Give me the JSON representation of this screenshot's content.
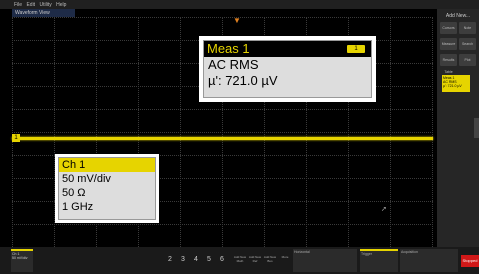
{
  "menu": [
    "File",
    "Edit",
    "Utility",
    "Help"
  ],
  "waveform_view_label": "Waveform View",
  "measurement_badge": {
    "title": "Meas 1",
    "number": "1",
    "type": "AC RMS",
    "value": "µ': 721.0 µV"
  },
  "channel_badge": {
    "title": "Ch 1",
    "scale": "50 mV/div",
    "termination": "50 Ω",
    "bandwidth": "1 GHz"
  },
  "right_panel": {
    "title": "Add New...",
    "buttons": [
      "Cursors",
      "Note",
      "Measure",
      "Search",
      "Results Table",
      "Plot"
    ],
    "meas_label": "Meas 1",
    "meas_type": "AC RMS",
    "meas_value": "µ': 721.0 µV"
  },
  "bottom": {
    "channel_numbers": [
      "2",
      "3",
      "4",
      "5",
      "6"
    ],
    "add_buttons": [
      "Add New Math",
      "Add New Ref",
      "Add New Bus"
    ],
    "more_label": "More",
    "horizontal_label": "Horizontal",
    "trigger_label": "Trigger",
    "acquisition_label": "Acquisition",
    "stop_label": "Stopped"
  },
  "colors": {
    "channel1": "#e6d400",
    "measurement_header": "#000000",
    "trigger_marker": "#e08020",
    "stop_button": "#d01818"
  }
}
